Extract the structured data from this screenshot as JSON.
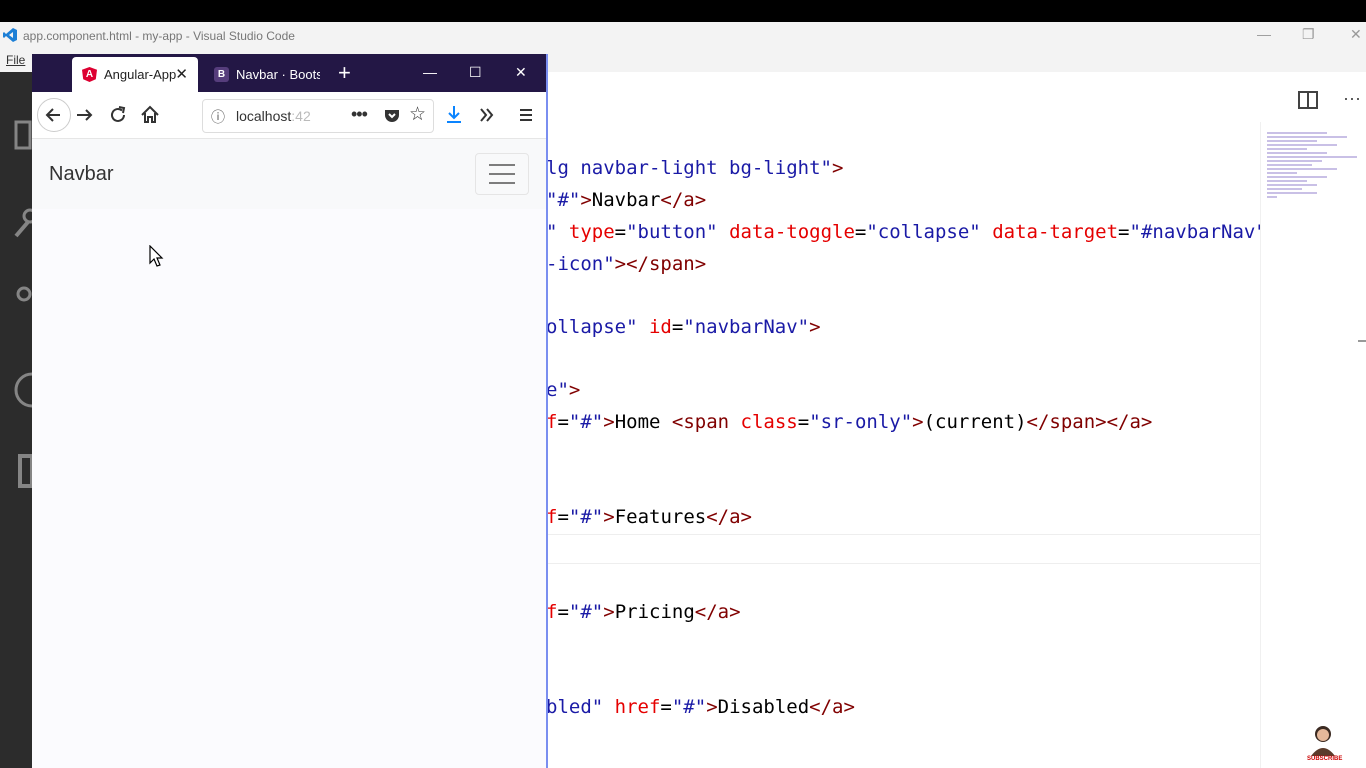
{
  "vscode": {
    "window_title": "app.component.html - my-app - Visual Studio Code",
    "menu_file": "File",
    "window_controls": {
      "minimize": "—",
      "maximize": "❐",
      "close": "✕"
    },
    "editor_actions": {
      "split": "split-editor-icon",
      "more": "···"
    }
  },
  "code": {
    "lines": [
      {
        "parts": [
          {
            "t": "lg navbar-light bg-light\"",
            "c": "str"
          },
          {
            "t": ">",
            "c": "tag"
          }
        ]
      },
      {
        "parts": [
          {
            "t": "\"#\"",
            "c": "str"
          },
          {
            "t": ">",
            "c": "tag"
          },
          {
            "t": "Navbar",
            "c": "txt"
          },
          {
            "t": "</a>",
            "c": "tag"
          }
        ]
      },
      {
        "parts": [
          {
            "t": "\" ",
            "c": "str"
          },
          {
            "t": "type",
            "c": "attr"
          },
          {
            "t": "=",
            "c": "txt"
          },
          {
            "t": "\"button\" ",
            "c": "str"
          },
          {
            "t": "data-toggle",
            "c": "attr"
          },
          {
            "t": "=",
            "c": "txt"
          },
          {
            "t": "\"collapse\" ",
            "c": "str"
          },
          {
            "t": "data-target",
            "c": "attr"
          },
          {
            "t": "=",
            "c": "txt"
          },
          {
            "t": "\"#navbarNav\"",
            "c": "str"
          }
        ]
      },
      {
        "parts": [
          {
            "t": "-icon\"",
            "c": "str"
          },
          {
            "t": "></span>",
            "c": "tag"
          }
        ]
      },
      {
        "parts": [
          {
            "t": "ollapse\" ",
            "c": "str"
          },
          {
            "t": "id",
            "c": "attr"
          },
          {
            "t": "=",
            "c": "txt"
          },
          {
            "t": "\"navbarNav\"",
            "c": "str"
          },
          {
            "t": ">",
            "c": "tag"
          }
        ]
      },
      {
        "parts": [
          {
            "t": "e\"",
            "c": "str"
          },
          {
            "t": ">",
            "c": "tag"
          }
        ]
      },
      {
        "parts": [
          {
            "t": "f",
            "c": "attr"
          },
          {
            "t": "=",
            "c": "txt"
          },
          {
            "t": "\"#\"",
            "c": "str"
          },
          {
            "t": ">",
            "c": "tag"
          },
          {
            "t": "Home ",
            "c": "txt"
          },
          {
            "t": "<span ",
            "c": "tag"
          },
          {
            "t": "class",
            "c": "attr"
          },
          {
            "t": "=",
            "c": "txt"
          },
          {
            "t": "\"sr-only\"",
            "c": "str"
          },
          {
            "t": ">",
            "c": "tag"
          },
          {
            "t": "(current)",
            "c": "txt"
          },
          {
            "t": "</span></a>",
            "c": "tag"
          }
        ]
      },
      {
        "parts": [
          {
            "t": "f",
            "c": "attr"
          },
          {
            "t": "=",
            "c": "txt"
          },
          {
            "t": "\"#\"",
            "c": "str"
          },
          {
            "t": ">",
            "c": "tag"
          },
          {
            "t": "Features",
            "c": "txt"
          },
          {
            "t": "</a>",
            "c": "tag"
          }
        ]
      },
      {
        "parts": [
          {
            "t": "f",
            "c": "attr"
          },
          {
            "t": "=",
            "c": "txt"
          },
          {
            "t": "\"#\"",
            "c": "str"
          },
          {
            "t": ">",
            "c": "tag"
          },
          {
            "t": "Pricing",
            "c": "txt"
          },
          {
            "t": "</a>",
            "c": "tag"
          }
        ]
      },
      {
        "parts": [
          {
            "t": "bled\" ",
            "c": "str"
          },
          {
            "t": "href",
            "c": "attr"
          },
          {
            "t": "=",
            "c": "txt"
          },
          {
            "t": "\"#\"",
            "c": "str"
          },
          {
            "t": ">",
            "c": "tag"
          },
          {
            "t": "Disabled",
            "c": "txt"
          },
          {
            "t": "</a>",
            "c": "tag"
          }
        ]
      }
    ]
  },
  "firefox": {
    "tabs": [
      {
        "label": "Angular-App",
        "icon": "angular-icon",
        "active": true
      },
      {
        "label": "Navbar · Bootstr",
        "icon": "bootstrap-icon",
        "active": false
      }
    ],
    "new_tab": "+",
    "window_controls": {
      "minimize": "—",
      "maximize": "☐",
      "close": "✕"
    },
    "url_host": "localhost",
    "url_port": ":42",
    "page_actions": "•••",
    "toolbar_icons": [
      "back-icon",
      "forward-icon",
      "reload-icon",
      "home-icon",
      "download-icon",
      "overflow-icon",
      "menu-icon"
    ]
  },
  "page": {
    "navbar_brand": "Navbar"
  },
  "subscribe": {
    "label": "SUBSCRIBE"
  },
  "colors": {
    "firefox_tabbar": "#231745",
    "string": "#1a1aa6",
    "attribute": "#e50000",
    "tag": "#800000"
  }
}
